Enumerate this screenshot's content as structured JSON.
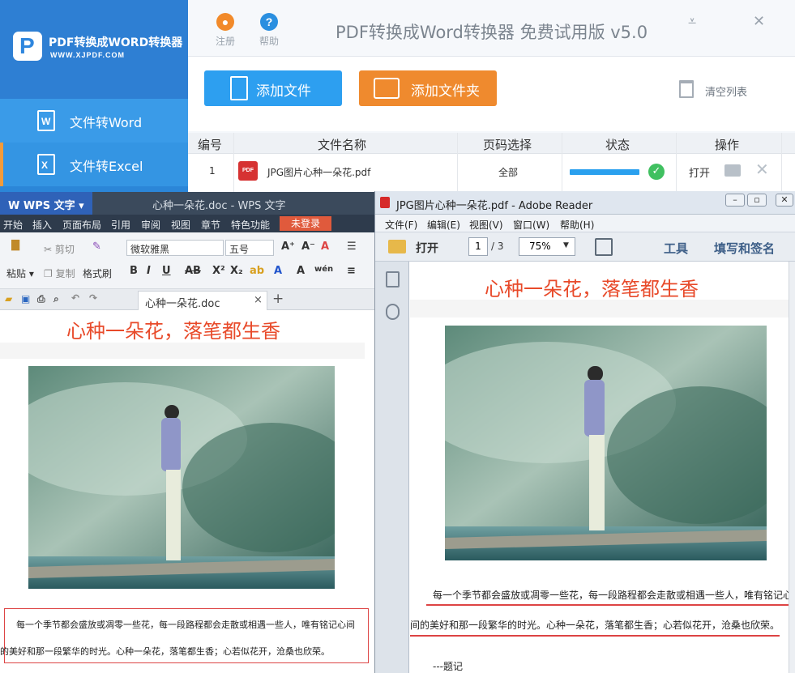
{
  "app": {
    "logo_title": "PDF转换成WORD转换器",
    "logo_url": "WWW.XJPDF.COM",
    "title": "PDF转换成Word转换器 免费试用版 v5.0",
    "register_label": "注册",
    "help_label": "帮助",
    "minimize_glyph": "⩡",
    "close_glyph": "✕"
  },
  "sidebar": {
    "items": [
      {
        "label": "文件转Word",
        "icon_letter": "W"
      },
      {
        "label": "文件转Excel",
        "icon_letter": "X"
      }
    ]
  },
  "toolbar": {
    "add_file": "添加文件",
    "add_folder": "添加文件夹",
    "clear_list": "清空列表"
  },
  "table": {
    "columns": [
      "编号",
      "文件名称",
      "页码选择",
      "状态",
      "操作"
    ],
    "rows": [
      {
        "index": "1",
        "filename": "JPG图片心种一朵花.pdf",
        "pages": "全部",
        "progress": 1.0,
        "status_icon": "check-icon",
        "action_open": "打开"
      }
    ]
  },
  "wps": {
    "brand": "W WPS 文字 ▾",
    "title": "心种一朵花.doc - WPS 文字",
    "menu": [
      "开始",
      "插入",
      "页面布局",
      "引用",
      "审阅",
      "视图",
      "章节",
      "特色功能"
    ],
    "login": "未登录",
    "ribbon": {
      "cut": "剪切",
      "copy": "复制",
      "paste": "粘贴 ▾",
      "format_painter": "格式刷",
      "font": "微软雅黑",
      "size": "五号"
    },
    "doc_tab": "心种一朵花.doc",
    "tab_close": "×",
    "tab_plus": "+",
    "heading": "心种一朵花，落笔都生香",
    "para1": "每一个季节都会盛放或凋零一些花，每一段路程都会走散或相遇一些人，唯有铭记心间",
    "para2": "的美好和那一段繁华的时光。心种一朵花，落笔都生香；心若似花开，沧桑也欣荣。"
  },
  "reader": {
    "title": "JPG图片心种一朵花.pdf - Adobe Reader",
    "menu": [
      "文件(F)",
      "编辑(E)",
      "视图(V)",
      "窗口(W)",
      "帮助(H)"
    ],
    "open": "打开",
    "page": "1",
    "page_total": "/ 3",
    "zoom": "75%",
    "tools": "工具",
    "fill_sign": "填写和签名",
    "heading": "心种一朵花，落笔都生香",
    "para1": "每一个季节都会盛放或凋零一些花，每一段路程都会走散或相遇一些人，唯有铭记心",
    "para2": "间的美好和那一段繁华的时光。心种一朵花，落笔都生香；心若似花开，沧桑也欣荣。",
    "signature": "---题记"
  },
  "colors": {
    "brand_blue": "#2e7fd3",
    "accent_orange": "#ef8a2e",
    "heading_red": "#e84a2a",
    "success_green": "#40c060"
  }
}
